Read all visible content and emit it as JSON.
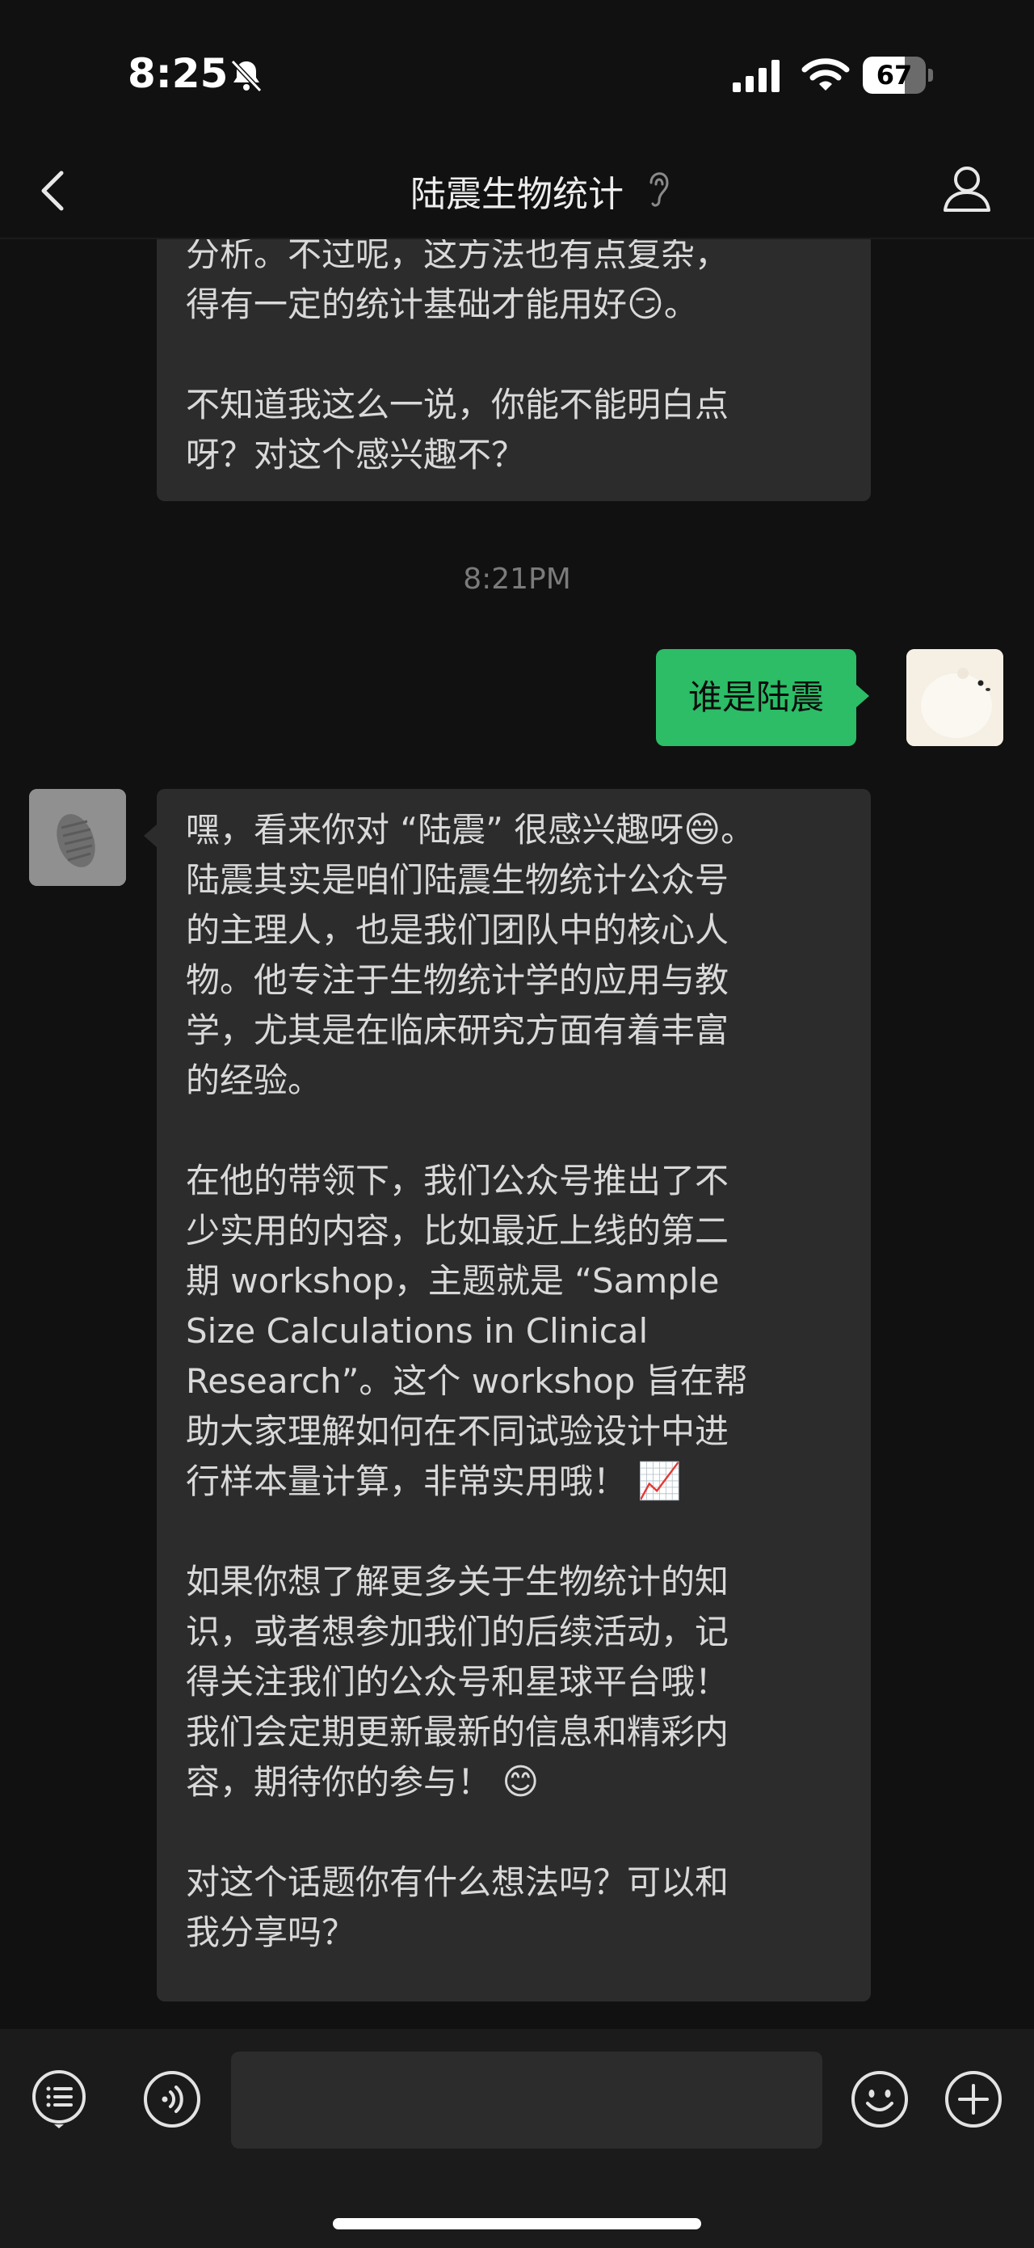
{
  "status_bar": {
    "time": "8:25",
    "battery": "67",
    "battery_level": 0.67
  },
  "header": {
    "title": "陆震生物统计"
  },
  "messages": {
    "prev_bot_partial": {
      "lines_top": "分析。不过呢，这方法也有点复杂，",
      "line2_text": "得有一定的统计基础才能用好",
      "line2_emoji": "😏",
      "line2_end": "。",
      "para2": "不知道我这么一说，你能不能明白点\n呀？对这个感兴趣不？"
    },
    "timestamp": "8:21PM",
    "user_message": "谁是陆震",
    "bot_reply": {
      "p1_start": "嘿，看来你对 “陆震” 很感兴趣呀",
      "p1_emoji": "😄",
      "p1_rest": "。\n陆震其实是咱们陆震生物统计公众号\n的主理人，也是我们团队中的核心人\n物。他专注于生物统计学的应用与教\n学，尤其是在临床研究方面有着丰富\n的经验。",
      "p2": "在他的带领下，我们公众号推出了不\n少实用的内容，比如最近上线的第二\n期 workshop，主题就是 “Sample\nSize Calculations in Clinical\nResearch”。这个 workshop 旨在帮\n助大家理解如何在不同试验设计中进\n行样本量计算，非常实用哦！",
      "p2_emoji": "📈",
      "p3": "如果你想了解更多关于生物统计的知\n识，或者想参加我们的后续活动，记\n得关注我们的公众号和星球平台哦！\n我们会定期更新最新的信息和精彩内\n容，期待你的参与！",
      "p3_emoji": "😊",
      "p4": "对这个话题你有什么想法吗？可以和\n我分享吗？"
    }
  },
  "input": {
    "placeholder": ""
  },
  "colors": {
    "bubble_out": "#2cbd66",
    "bubble_in": "#2c2c2c",
    "background": "#111111"
  },
  "icons": [
    "bell-slash-icon",
    "signal-icon",
    "wifi-icon",
    "battery-icon",
    "back-chevron-icon",
    "ear-icon",
    "profile-icon",
    "list-icon",
    "voice-icon",
    "emoji-icon",
    "plus-icon"
  ]
}
